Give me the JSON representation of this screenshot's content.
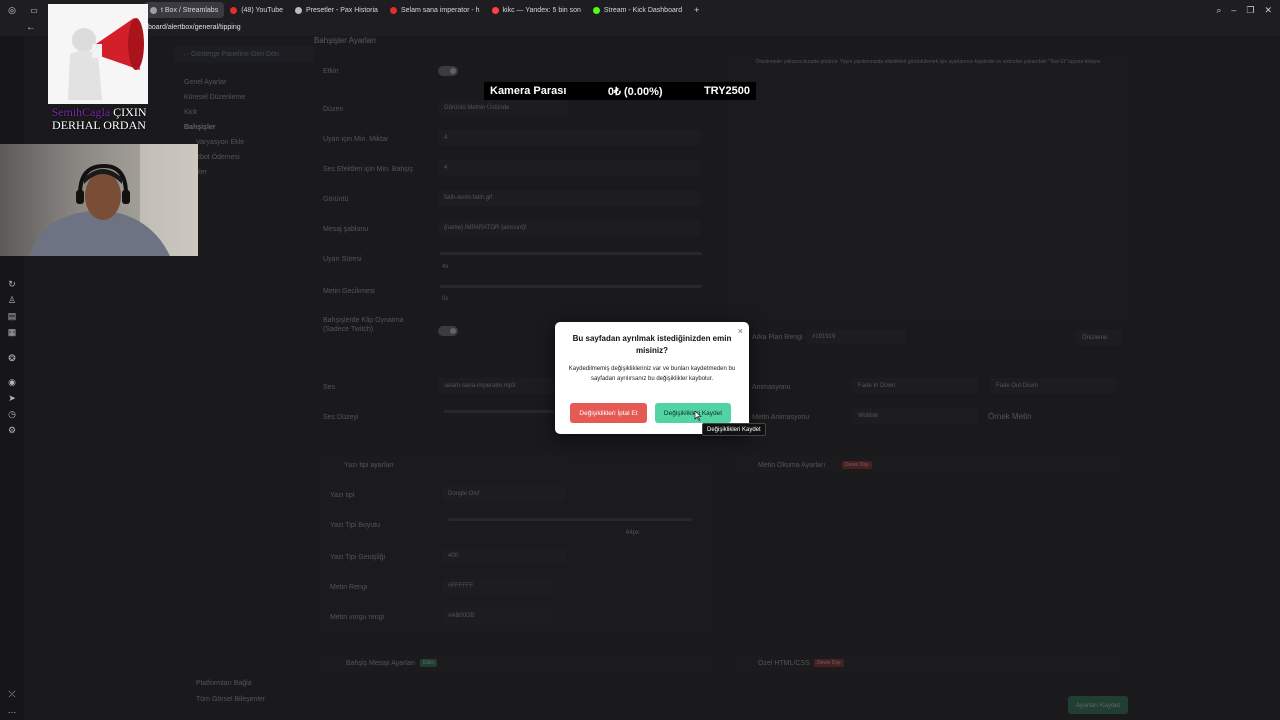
{
  "browser": {
    "tabs": [
      {
        "label": "t Box / Streamlabs",
        "active": true,
        "color": "#9aa0a6"
      },
      {
        "label": "(48) YouTube",
        "active": false,
        "color": "#e22d2d"
      },
      {
        "label": "Presetler - Pax Historia",
        "active": false,
        "color": "#bbbbbb"
      },
      {
        "label": "Selam sana imperator - h",
        "active": false,
        "color": "#e22d2d"
      },
      {
        "label": "kikc — Yandex: 5 bin son",
        "active": false,
        "color": "#ff4040"
      },
      {
        "label": "Stream - Kick Dashboard",
        "active": false,
        "color": "#53fc18"
      }
    ],
    "new_tab": "+",
    "address": "board/alertbox/general/tipping"
  },
  "overlay": {
    "caption_nick": "SemihCagla",
    "caption_rest": " ÇIXIN DERHAL ORDAN"
  },
  "donation_bar": {
    "label": "Kamera Parası",
    "progress": "0₺ (0.00%)",
    "goal": "TRY2500"
  },
  "app": {
    "back_link": "← Gösterge Paneline Geri Dön",
    "title": "Bahşişler Ayarları",
    "sidebar": [
      {
        "label": "Genel Ayarlar"
      },
      {
        "label": "Küresel Düzenleme"
      },
      {
        "label": "Kick"
      },
      {
        "label": "Bahşişler"
      },
      {
        "label": "Varyasyon Ekle"
      },
      {
        "label": "Bulutbot Ödemesi"
      },
      {
        "label": "Ürünler"
      }
    ],
    "form": [
      {
        "label": "Etkin"
      },
      {
        "label": "Düzen",
        "value": "Görüntü Metnin Üstünde"
      },
      {
        "label": "Uyarı için Min. Miktar",
        "value": "4"
      },
      {
        "label": "Ses Efektleri için Min. Bahşiş",
        "value": "4"
      },
      {
        "label": "Görüntü",
        "value": "fatih-terim-fatih.gif"
      },
      {
        "label": "Mesaj şablonu",
        "value": "{name} İMPARATOR {amount}!"
      },
      {
        "label": "Uyarı Süresi",
        "value": "4s"
      },
      {
        "label": "Metin Gecikmesi",
        "value": "0s"
      },
      {
        "label": "Bahşişlerde Klip Oynatma (Sadece Twitch)"
      }
    ],
    "preview_notice": "Önizlemeler yalnızca burada görünür. Yayın yazılımınızda etkinlikleri görüntülemek için ayarlarınızı kaydedin ve ardından yukarıdaki \"Test Et\" tuşuna tıklayın",
    "bg_color_label": "Arka Plan Rengi",
    "bg_color_value": "#191919",
    "preview_btn": "Önizleme",
    "sound_label": "Ses",
    "sound_file": "selam-sana-imperator.mp3",
    "volume_label": "Ses Düzeyi",
    "anim_label": "Animasyonu",
    "anim_in": "Fade In Down",
    "anim_out": "Fade Out Down",
    "text_anim_label": "Metin Animasyonu",
    "text_anim_value": "Wobble",
    "sample_text": "Örnek Metin",
    "font_section": "Yazı tipi ayarları",
    "font_label": "Yazı tipi",
    "font_value": "Dongle Olsf",
    "font_size_label": "Yazı Tipi Boyutu",
    "font_size_value": "64px",
    "font_weight_label": "Yazı Tipi Genişliği",
    "font_weight_value": "400",
    "text_color_label": "Metin Rengi",
    "text_color_value": "#FFFFFF",
    "highlight_label": "Metin vurgu rengi",
    "highlight_value": "#AB00DB",
    "speech_section": "Metin Okuma Ayarları",
    "speech_badge": "Devre Dışı",
    "tip_msg_section": "Bahşiş Mesajı Ayarları",
    "tip_msg_badge": "Etkin",
    "custom_css_section": "Özel HTML/CSS",
    "custom_css_badge": "Devre Dışı",
    "connect_platforms": "Platformları Bağla",
    "all_widgets": "Tüm Görsel Bileşenler",
    "save_settings": "Ayarları Kaydet"
  },
  "modal": {
    "close": "×",
    "title": "Bu sayfadan ayrılmak istediğinizden emin misiniz?",
    "body": "Kaydedilmemiş değişiklikleriniz var ve bunları kaydetmeden bu sayfadan ayrılırsanız bu değişiklikler kaybolur.",
    "cancel_label": "Değişiklikleri İptal Et",
    "save_label": "Değişiklikleri Kaydet",
    "tooltip": "Değişiklikleri Kaydet"
  },
  "colors": {
    "cancel_button": "#e55a55",
    "save_button": "#52d3a4"
  }
}
